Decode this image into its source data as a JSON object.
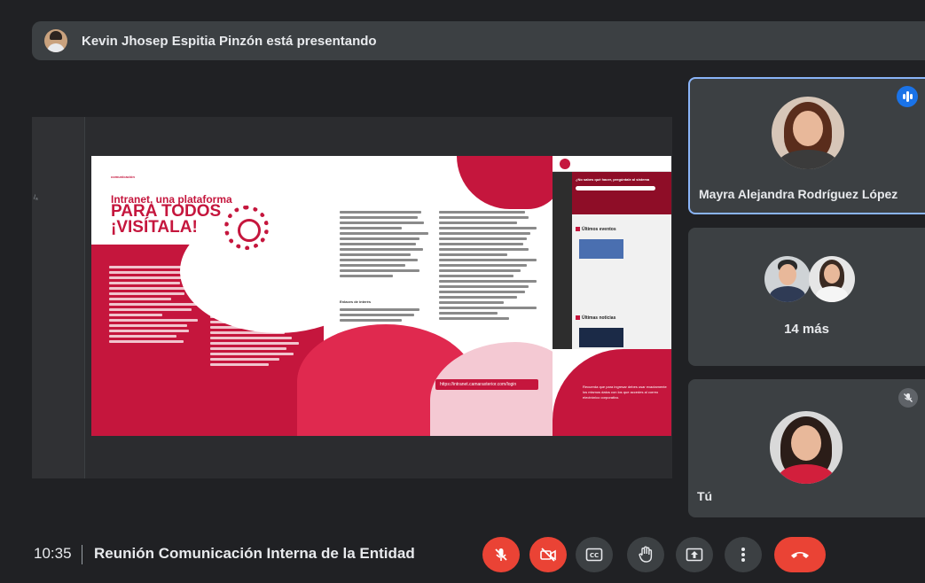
{
  "banner": {
    "presenter_text": "Kevin Jhosep Espitia Pinzón está presentando"
  },
  "stage": {
    "side_mark": "/ₐ"
  },
  "document": {
    "kicker": "comunicación",
    "title_line1": "Intranet, una plataforma",
    "title_line2": "PARA TODOS",
    "title_line3": "¡VISÍTALA!",
    "links_heading": "Enlaces de interés",
    "link": "https://intranet.camaraxterior.com/login",
    "right_panel": {
      "hero_text": "¿No sabes qué hacer, pregúntale al sistema",
      "section1": "Últimos eventos",
      "section2": "Últimas noticias",
      "footer_text": "Recuerda que para ingresar debes usar exactamente los mismos datos con los que accedes al correo electrónico corporativo."
    }
  },
  "participants": [
    {
      "name": "Mayra Alejandra Rodríguez López",
      "speaking": true
    },
    {
      "more_label": "14 más"
    },
    {
      "name": "Tú",
      "muted": true
    }
  ],
  "bottom_bar": {
    "time": "10:35",
    "separator": "|",
    "meeting_title": "Reunión Comunicación Interna de la Entidad"
  },
  "controls": [
    {
      "name": "mic-off",
      "state": "off"
    },
    {
      "name": "camera-off",
      "state": "off"
    },
    {
      "name": "captions",
      "label": "CC"
    },
    {
      "name": "raise-hand"
    },
    {
      "name": "present"
    },
    {
      "name": "more-options"
    },
    {
      "name": "leave-call"
    }
  ],
  "colors": {
    "background": "#202124",
    "surface": "#3c4043",
    "accent_blue": "#8ab4f8",
    "danger_red": "#ea4335",
    "doc_red": "#c5163d"
  }
}
